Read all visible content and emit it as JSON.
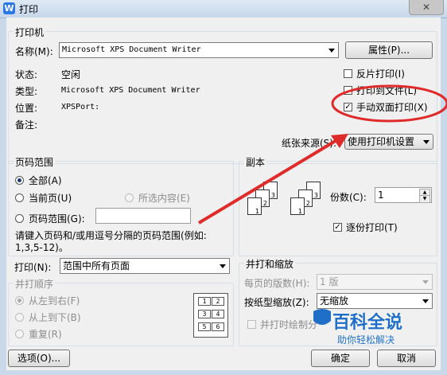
{
  "window": {
    "title": "打印",
    "close_glyph": "✕"
  },
  "printer": {
    "group_label": "打印机",
    "name_label": "名称(M):",
    "name_value": "Microsoft XPS Document Writer",
    "properties_button": "属性(P)...",
    "status_label": "状态:",
    "status_value": "空闲",
    "type_label": "类型:",
    "type_value": "Microsoft XPS Document Writer",
    "location_label": "位置:",
    "location_value": "XPSPort:",
    "comment_label": "备注:",
    "reverse_print": "反片打印(I)",
    "print_to_file": "打印到文件(L)",
    "manual_duplex": "手动双面打印(X)",
    "paper_source_label": "纸张来源(S):",
    "paper_source_value": "使用打印机设置"
  },
  "page_range": {
    "group_label": "页码范围",
    "all": "全部(A)",
    "current": "当前页(U)",
    "selection": "所选内容(E)",
    "pages": "页码范围(G):",
    "hint_line1": "请键入页码和/或用逗号分隔的页码范围(例如:",
    "hint_line2": "1,3,5-12)。"
  },
  "copies": {
    "group_label": "副本",
    "count_label": "份数(C):",
    "count_value": "1",
    "collate": "逐份打印(T)"
  },
  "print_what": {
    "label": "打印(N):",
    "value": "范围中所有页面"
  },
  "order": {
    "group_label": "并打顺序",
    "left_to_right": "从左到右(F)",
    "top_to_bottom": "从上到下(B)",
    "repeat": "重复(R)",
    "grid": [
      "1",
      "2",
      "3",
      "4",
      "5",
      "6"
    ]
  },
  "zoom": {
    "group_label": "并打和缩放",
    "pages_per_sheet_label": "每页的版数(H):",
    "pages_per_sheet_value": "1 版",
    "scale_label": "按纸型缩放(Z):",
    "scale_value": "无缩放",
    "draw_separator": "并打时绘制分"
  },
  "footer": {
    "options_button": "选项(O)...",
    "ok_button": "确定",
    "cancel_button": "取消"
  },
  "watermark": {
    "main": "百科全说",
    "sub": "助你轻松解决"
  },
  "colors": {
    "annotation_red": "#e02b2b",
    "watermark_blue": "#1f6fc9"
  }
}
